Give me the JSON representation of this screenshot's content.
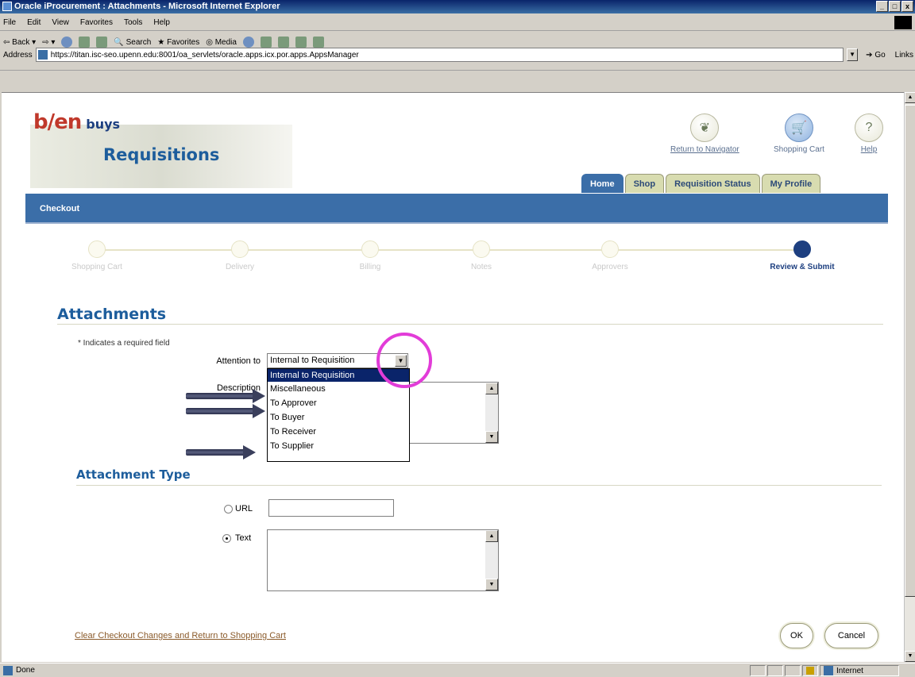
{
  "window": {
    "title": "Oracle iProcurement : Attachments - Microsoft Internet Explorer"
  },
  "menu": [
    "File",
    "Edit",
    "View",
    "Favorites",
    "Tools",
    "Help"
  ],
  "toolbar": {
    "back": "Back",
    "search": "Search",
    "favorites": "Favorites",
    "media": "Media"
  },
  "address": {
    "label": "Address",
    "url": "https://titan.isc-seo.upenn.edu:8001/oa_servlets/oracle.apps.icx.por.apps.AppsManager",
    "go": "Go",
    "links": "Links"
  },
  "brand": {
    "logo": "b/en",
    "logo_suffix": "buys",
    "app": "Requisitions"
  },
  "global": {
    "navigator": "Return to Navigator",
    "cart": "Shopping Cart",
    "help": "Help"
  },
  "tabs": [
    "Home",
    "Shop",
    "Requisition Status",
    "My Profile"
  ],
  "bar": {
    "title": "Checkout"
  },
  "train": {
    "steps": [
      "Shopping Cart",
      "Delivery",
      "Billing",
      "Notes",
      "Approvers",
      "Review & Submit"
    ],
    "current": 5
  },
  "attachments": {
    "heading": "Attachments",
    "required_note": "Indicates a required field",
    "attention_label": "Attention to",
    "attention_value": "Internal to Requisition",
    "attention_options": [
      "Internal to Requisition",
      "Miscellaneous",
      "To Approver",
      "To Buyer",
      "To Receiver",
      "To Supplier"
    ],
    "description_label": "Description"
  },
  "type": {
    "heading": "Attachment Type",
    "url_label": "URL",
    "text_label": "Text",
    "selected": "Text"
  },
  "footer": {
    "link": "Clear Checkout Changes and Return to Shopping Cart",
    "ok": "OK",
    "cancel": "Cancel"
  },
  "status": {
    "text": "Done",
    "zone": "Internet"
  },
  "colors": {
    "brand_blue": "#3b6ea8",
    "highlight": "#e23cd8",
    "selected_option": "#0a246a"
  }
}
